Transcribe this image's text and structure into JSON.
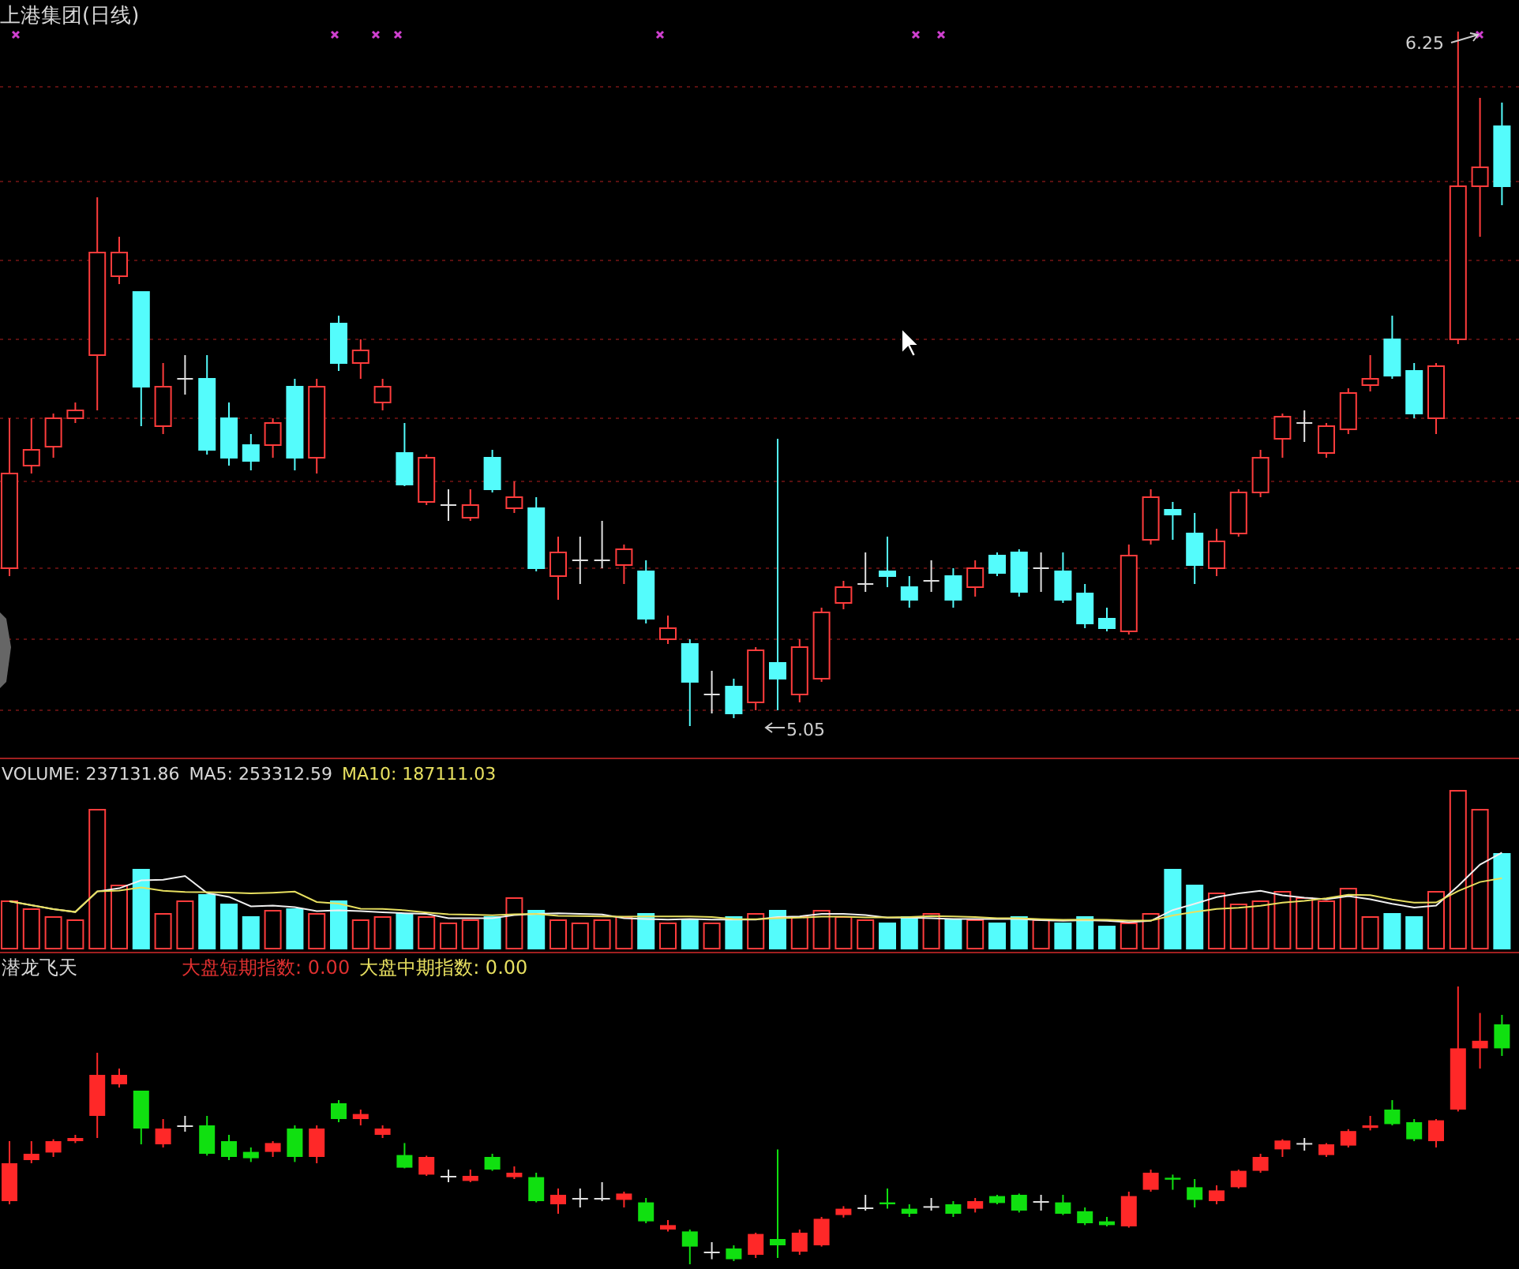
{
  "window": {
    "title": "上港集团(日线)"
  },
  "price_chart": {
    "high_label": "6.25",
    "low_label": "5.05"
  },
  "volume_chart": {
    "label": "VOLUME: 237131.86",
    "ma5": "MA5: 253312.59",
    "ma10": "MA10: 187111.03"
  },
  "indicator_chart": {
    "title": "潜龙飞天",
    "short_index": "大盘短期指数: 0.00",
    "mid_index": "大盘中期指数: 0.00"
  }
}
